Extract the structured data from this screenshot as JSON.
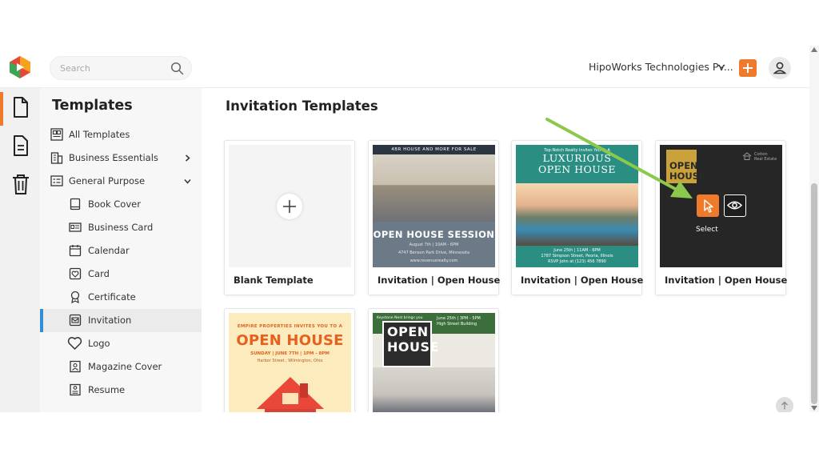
{
  "header": {
    "search_placeholder": "Search",
    "org_name": "HipoWorks Technologies Pv...",
    "accent_color": "#f07a2c"
  },
  "rail": {
    "icons": [
      "templates-icon",
      "document-icon",
      "trash-icon"
    ]
  },
  "sidebar": {
    "title": "Templates",
    "items": [
      {
        "label": "All Templates",
        "icon": "grid-icon"
      },
      {
        "label": "Business Essentials",
        "icon": "building-icon"
      },
      {
        "label": "General Purpose",
        "icon": "list-icon"
      },
      {
        "label": "Book Cover",
        "icon": "book-icon"
      },
      {
        "label": "Business Card",
        "icon": "id-card-icon"
      },
      {
        "label": "Calendar",
        "icon": "calendar-icon"
      },
      {
        "label": "Card",
        "icon": "card-icon"
      },
      {
        "label": "Certificate",
        "icon": "award-icon"
      },
      {
        "label": "Invitation",
        "icon": "invitation-icon",
        "active": true
      },
      {
        "label": "Logo",
        "icon": "heart-icon"
      },
      {
        "label": "Magazine Cover",
        "icon": "magazine-icon"
      },
      {
        "label": "Resume",
        "icon": "resume-icon"
      }
    ]
  },
  "main": {
    "title": "Invitation Templates",
    "cards": [
      {
        "label": "Blank Template"
      },
      {
        "label": "Invitation | Open House",
        "banner": "4BR HOUSE AND MORE FOR SALE",
        "headline": "OPEN HOUSE SESSION",
        "date": "August 7th | 10AM - 6PM",
        "address": "4747 Benson Park Drive, Minnesota",
        "website": "www.revenuerealty.com"
      },
      {
        "label": "Invitation | Open House",
        "intro": "Top-Notch Realty Invites You To A",
        "headline_1": "LUXURIOUS",
        "headline_2": "OPEN HOUSE",
        "date": "June 25th | 11AM - 6PM",
        "address": "1787 Simpson Street, Peoria, Illinois",
        "rsvp": "RSVP John at (123) 456 7890"
      },
      {
        "label": "Invitation | Open House",
        "headline_1": "OPEN",
        "headline_2": "HOUSE",
        "brand_1": "Cotton",
        "brand_2": "Real Estate",
        "select_tooltip": "Select"
      },
      {
        "label": "",
        "intro": "EMPIRE PROPERTIES INVITES YOU TO A",
        "headline": "OPEN HOUSE",
        "date": "SUNDAY | JUNE 7TH | 1PM - 8PM",
        "address": "Harbor Street , Wilmington, Ohio"
      },
      {
        "label": "",
        "intro": "Keystone Nest brings you",
        "headline_1": "OPEN",
        "headline_2": "HOUSE",
        "date": "June 25th | 3PM - 5PM",
        "address": "High Street Building"
      }
    ]
  }
}
